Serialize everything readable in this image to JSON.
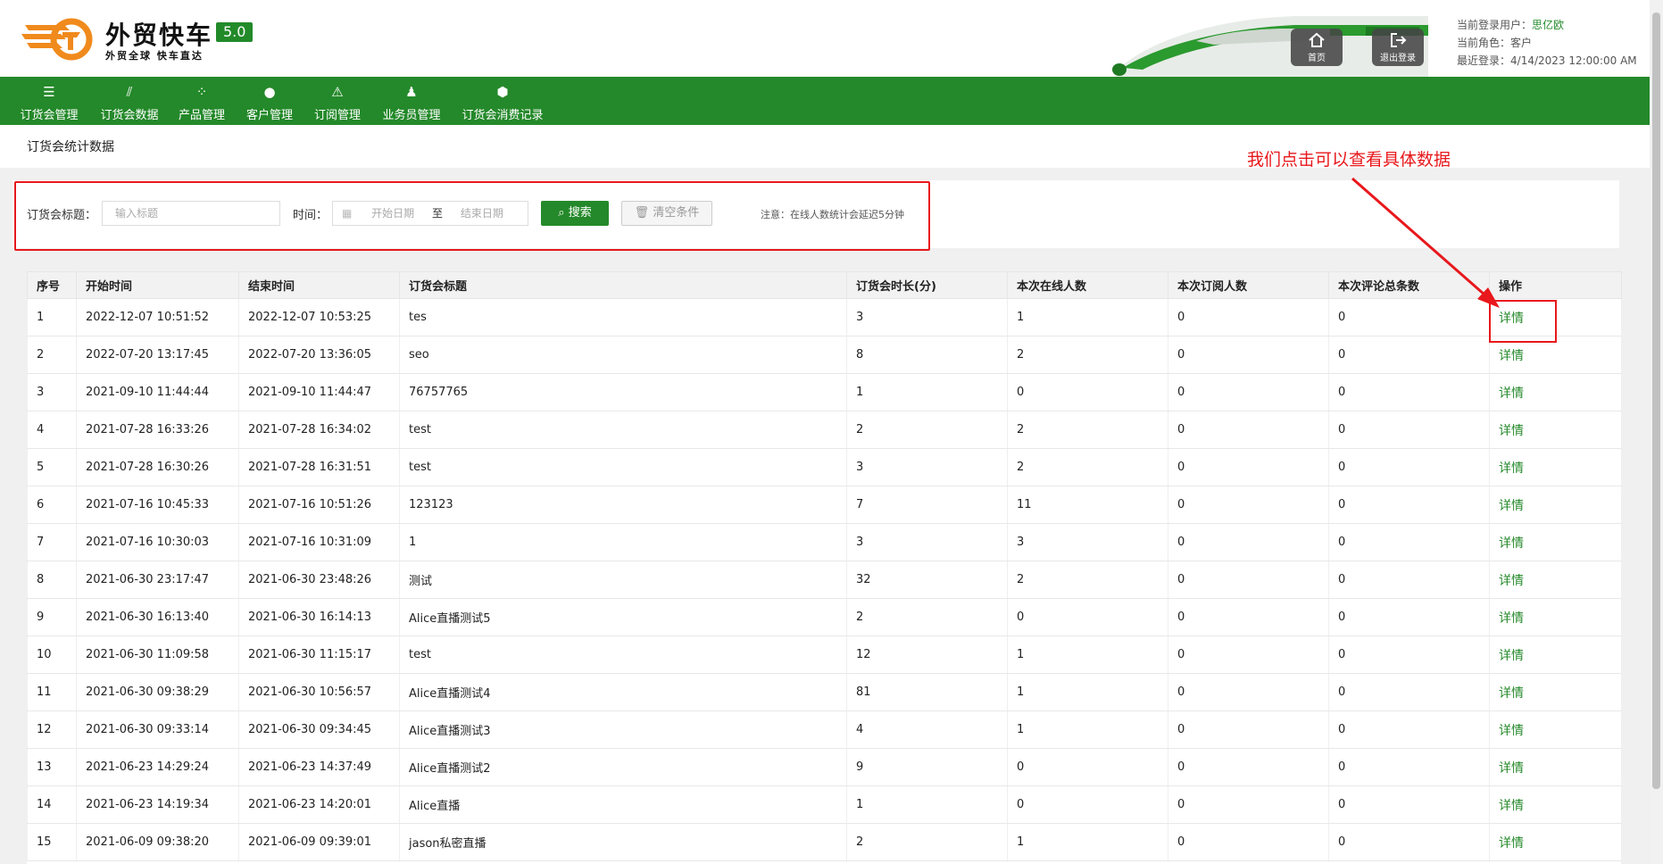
{
  "header": {
    "brand": "外贸快车",
    "version": "5.0",
    "slogan": "外贸全球 快车直达",
    "home_label": "首页",
    "logout_label": "退出登录",
    "user_label": "当前登录用户：",
    "user_name": "思亿欧",
    "role_label": "当前角色：",
    "role": "客户",
    "last_login_label": "最近登录：",
    "last_login": "4/14/2023 12:00:00 AM"
  },
  "nav": [
    {
      "label": "订货会管理",
      "icon": "list-icon"
    },
    {
      "label": "订货会数据",
      "icon": "chart-icon"
    },
    {
      "label": "产品管理",
      "icon": "grid-icon"
    },
    {
      "label": "客户管理",
      "icon": "user-icon"
    },
    {
      "label": "订阅管理",
      "icon": "warning-icon"
    },
    {
      "label": "业务员管理",
      "icon": "team-icon"
    },
    {
      "label": "订货会消费记录",
      "icon": "box-icon"
    }
  ],
  "page_title": "订货会统计数据",
  "search": {
    "title_label": "订货会标题：",
    "title_placeholder": "输入标题",
    "time_label": "时间：",
    "start_placeholder": "开始日期",
    "to": "至",
    "end_placeholder": "结束日期",
    "search_button": "搜索",
    "clear_button": "清空条件",
    "notice": "注意：在线人数统计会延迟5分钟"
  },
  "annotation": "我们点击可以查看具体数据",
  "colors": {
    "primary": "#24892a",
    "annotation": "#e8181c"
  },
  "table": {
    "headers": [
      "序号",
      "开始时间",
      "结束时间",
      "订货会标题",
      "订货会时长(分)",
      "本次在线人数",
      "本次订阅人数",
      "本次评论总条数",
      "操作"
    ],
    "action_label": "详情",
    "rows": [
      [
        "1",
        "2022-12-07 10:51:52",
        "2022-12-07 10:53:25",
        "tes",
        "3",
        "1",
        "0",
        "0"
      ],
      [
        "2",
        "2022-07-20 13:17:45",
        "2022-07-20 13:36:05",
        "seo",
        "8",
        "2",
        "0",
        "0"
      ],
      [
        "3",
        "2021-09-10 11:44:44",
        "2021-09-10 11:44:47",
        "76757765",
        "1",
        "0",
        "0",
        "0"
      ],
      [
        "4",
        "2021-07-28 16:33:26",
        "2021-07-28 16:34:02",
        "test",
        "2",
        "2",
        "0",
        "0"
      ],
      [
        "5",
        "2021-07-28 16:30:26",
        "2021-07-28 16:31:51",
        "test",
        "3",
        "2",
        "0",
        "0"
      ],
      [
        "6",
        "2021-07-16 10:45:33",
        "2021-07-16 10:51:26",
        "123123",
        "7",
        "11",
        "0",
        "0"
      ],
      [
        "7",
        "2021-07-16 10:30:03",
        "2021-07-16 10:31:09",
        "1",
        "3",
        "3",
        "0",
        "0"
      ],
      [
        "8",
        "2021-06-30 23:17:47",
        "2021-06-30 23:48:26",
        "测试",
        "32",
        "2",
        "0",
        "0"
      ],
      [
        "9",
        "2021-06-30 16:13:40",
        "2021-06-30 16:14:13",
        "Alice直播测试5",
        "2",
        "0",
        "0",
        "0"
      ],
      [
        "10",
        "2021-06-30 11:09:58",
        "2021-06-30 11:15:17",
        "test",
        "12",
        "1",
        "0",
        "0"
      ],
      [
        "11",
        "2021-06-30 09:38:29",
        "2021-06-30 10:56:57",
        "Alice直播测试4",
        "81",
        "1",
        "0",
        "0"
      ],
      [
        "12",
        "2021-06-30 09:33:14",
        "2021-06-30 09:34:45",
        "Alice直播测试3",
        "4",
        "1",
        "0",
        "0"
      ],
      [
        "13",
        "2021-06-23 14:29:24",
        "2021-06-23 14:37:49",
        "Alice直播测试2",
        "9",
        "0",
        "0",
        "0"
      ],
      [
        "14",
        "2021-06-23 14:19:34",
        "2021-06-23 14:20:01",
        "Alice直播",
        "1",
        "0",
        "0",
        "0"
      ],
      [
        "15",
        "2021-06-09 09:38:20",
        "2021-06-09 09:39:01",
        "jason私密直播",
        "2",
        "1",
        "0",
        "0"
      ]
    ]
  }
}
